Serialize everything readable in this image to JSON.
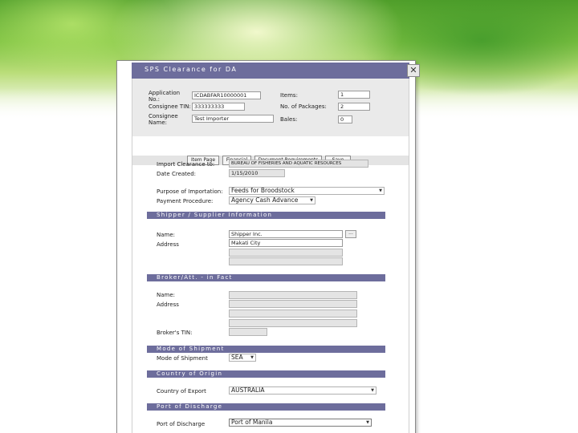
{
  "window": {
    "title": "SPS Clearance for DA",
    "close_glyph": "✕"
  },
  "header": {
    "app_no_label": "Application No.:",
    "app_no_value": "ICDABFAR10000001",
    "consignee_tin_label": "Consignee TIN:",
    "consignee_tin_value": "333333333",
    "consignee_name_label": "Consignee Name:",
    "consignee_name_value": "Test Importer",
    "items_label": "Items:",
    "items_value": "1",
    "packages_label": "No. of Packages:",
    "packages_value": "2",
    "bales_label": "Bales:",
    "bales_value": "0"
  },
  "toolbar": {
    "item_page": "Item Page",
    "financial": "Financial",
    "document_requirements": "Document Requirements",
    "save": "Save"
  },
  "clearance": {
    "import_clearance_label": "Import Clearance to:",
    "import_clearance_value": "BUREAU OF FISHERIES AND AQUATIC RESOURCES",
    "date_created_label": "Date Created:",
    "date_created_value": "1/15/2010",
    "purpose_label": "Purpose of Importation:",
    "purpose_value": "Feeds for Broodstock",
    "payment_label": "Payment Procedure:",
    "payment_value": "Agency Cash Advance"
  },
  "shipper": {
    "section_title": "Shipper / Supplier Information",
    "name_label": "Name:",
    "name_value": "Shipper Inc.",
    "lookup_label": "...",
    "address_label": "Address",
    "address_value": "Makati City"
  },
  "broker": {
    "section_title": "Broker/Att. - in Fact",
    "name_label": "Name:",
    "address_label": "Address",
    "tin_label": "Broker's TIN:"
  },
  "shipment": {
    "section_title": "Mode of Shipment",
    "mode_label": "Mode of Shipment",
    "mode_value": "SEA"
  },
  "origin": {
    "section_title": "Country of Origin",
    "export_label": "Country of Export",
    "export_value": "AUSTRALIA"
  },
  "discharge": {
    "section_title": "Port of Discharge",
    "port_label": "Port of Discharge",
    "port_value": "Port of Manila"
  },
  "icons": {
    "dropdown": "▼"
  }
}
